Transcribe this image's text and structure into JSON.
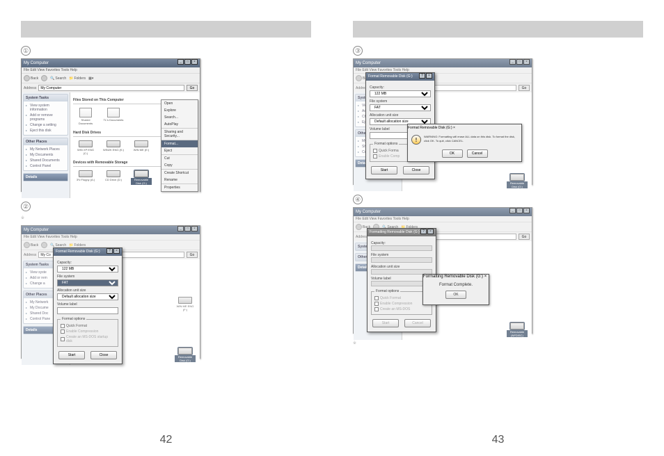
{
  "page_numbers": {
    "left": "42",
    "right": "43"
  },
  "steps": {
    "s1": {
      "marker": "①",
      "text": ""
    },
    "s2": {
      "marker": "②",
      "text": ""
    },
    "s3": {
      "marker": "③",
      "text": ""
    },
    "s4": {
      "marker": "④",
      "text": ""
    }
  },
  "win": {
    "title": "My Computer",
    "menu": "File   Edit   View   Favorites   Tools   Help",
    "back": "Back",
    "search": "Search",
    "folders": "Folders",
    "addr_label": "Address",
    "addr_value": "My Computer",
    "go": "Go"
  },
  "side": {
    "tasks": "System Tasks",
    "task_items": [
      "View system information",
      "Add or remove programs",
      "Change a setting",
      "Eject this disk"
    ],
    "other": "Other Places",
    "other_items": [
      "My Network Places",
      "My Documents",
      "Shared Documents",
      "Control Panel"
    ],
    "details": "Details"
  },
  "main": {
    "sec1": "Files Stored on This Computer",
    "sec2": "Hard Disk Drives",
    "sec3": "Devices with Removable Storage",
    "shared": "Shared Documents",
    "tls": "TL's Documents",
    "hd1": "WIN XP ENG (C:)",
    "hd2": "WIN2K ENG (K:)",
    "hd3": "WIN ME (E:)",
    "fl": "3½ Floppy (A:)",
    "cd": "CD Drive (D:)",
    "rm": "Removable Disk (G:)"
  },
  "ctx": {
    "open": "Open",
    "explore": "Explore",
    "search": "Search...",
    "autoplay": "AutoPlay",
    "sharing": "Sharing and Security...",
    "format": "Format...",
    "eject": "Eject",
    "cut": "Cut",
    "copy": "Copy",
    "shortcut": "Create Shortcut",
    "rename": "Rename",
    "properties": "Properties"
  },
  "fmt": {
    "title": "Format Removable Disk (G:)",
    "capacity": "Capacity:",
    "cap_val": "122 MB",
    "filesystem": "File system",
    "fs_val": "FAT",
    "alloc": "Allocation unit size",
    "alloc_val": "Default allocation size",
    "vol": "Volume label",
    "vol_val": "",
    "options": "Format options",
    "quick": "Quick Format",
    "compress": "Enable Compression",
    "bootdisk": "Create an MS-DOS startup disk",
    "start": "Start",
    "close": "Close"
  },
  "warn": {
    "title": "Format Removable Disk (G:)",
    "msg": "WARNING: Formatting will erase ALL data on this disk. To format the disk, click OK. To quit, click CANCEL.",
    "ok": "OK",
    "cancel": "Cancel"
  },
  "done": {
    "title": "Formatting Removable Disk (G:)",
    "msg": "Format Complete.",
    "ok": "OK"
  },
  "win2": {
    "addr_value": "My Co",
    "hd1_label": "WIN ME ENG (F:)",
    "rm_label": "Removable Disk (G:)"
  },
  "win4": {
    "rm_label": "Removable (NFDISC)"
  },
  "icons": {
    "min": "_",
    "max": "□",
    "close": "×",
    "help": "?"
  },
  "note": "※"
}
